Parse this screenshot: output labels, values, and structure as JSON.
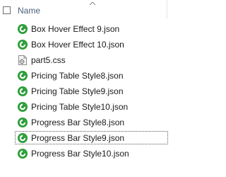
{
  "header": {
    "name_label": "Name"
  },
  "files": [
    {
      "name": "Box Hover Effect 9.json",
      "type": "json"
    },
    {
      "name": "Box Hover Effect 10.json",
      "type": "json"
    },
    {
      "name": "part5.css",
      "type": "css"
    },
    {
      "name": "Pricing Table Style8.json",
      "type": "json"
    },
    {
      "name": "Pricing Table Style9.json",
      "type": "json"
    },
    {
      "name": "Pricing Table Style10.json",
      "type": "json"
    },
    {
      "name": "Progress Bar Style8.json",
      "type": "json"
    },
    {
      "name": "Progress Bar Style9.json",
      "type": "json",
      "focused": true
    },
    {
      "name": "Progress Bar Style10.json",
      "type": "json"
    }
  ],
  "colors": {
    "json_icon_green": "#2e9e3a",
    "header_text": "#4c607a"
  },
  "icons": {
    "json": "json-file-icon",
    "css": "css-file-icon",
    "sort": "chevron-up-icon"
  }
}
